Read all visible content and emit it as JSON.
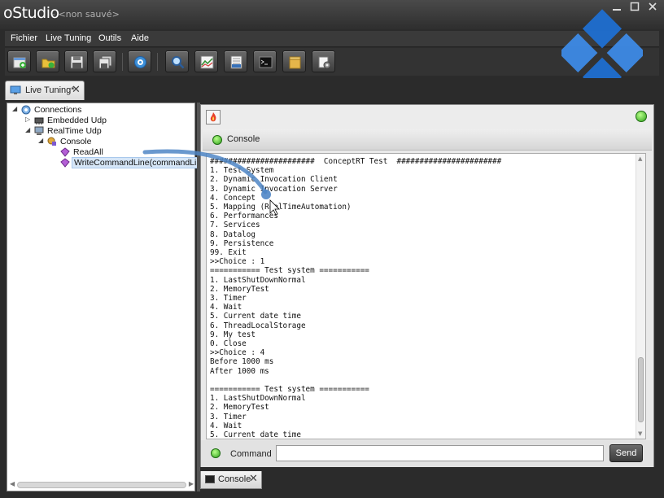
{
  "window": {
    "app_name": "oStudio",
    "subtitle": "- <non sauvé>"
  },
  "menu": {
    "items": [
      {
        "label": "Fichier"
      },
      {
        "label": "Live Tuning"
      },
      {
        "label": "Outils"
      },
      {
        "label": "Aide"
      }
    ]
  },
  "toolbar": {
    "icons": [
      "new-project-icon",
      "open-folder-icon",
      "save-icon",
      "save-all-icon",
      "settings-gear-icon",
      "search-icon",
      "chart-icon",
      "log-icon",
      "terminal-icon",
      "package-icon",
      "plugin-icon"
    ]
  },
  "tabs": {
    "document_tab": "Live Tuning*",
    "bottom_tab": "Console"
  },
  "tree": {
    "root": "Connections",
    "embedded": "Embedded Udp",
    "realtime": "RealTime Udp",
    "console": "Console",
    "read_all": "ReadAll",
    "write_cmd": "WriteCommandLine(commandLine)"
  },
  "console": {
    "header": "Console",
    "lines": [
      "#######################  ConceptRT Test  #######################",
      "1. Test System",
      "2. Dynamic Invocation Client",
      "3. Dynamic Invocation Server",
      "4. Concept",
      "5. Mapping (RealTimeAutomation)",
      "6. Performances",
      "7. Services",
      "8. Datalog",
      "9. Persistence",
      "99. Exit",
      ">>Choice : 1",
      "=========== Test system ===========",
      "1. LastShutDownNormal",
      "2. MemoryTest",
      "3. Timer",
      "4. Wait",
      "5. Current date time",
      "6. ThreadLocalStorage",
      "9. My test",
      "0. Close",
      ">>Choice : 4",
      "Before 1000 ms",
      "After 1000 ms",
      "",
      "=========== Test system ===========",
      "1. LastShutDownNormal",
      "2. MemoryTest",
      "3. Timer",
      "4. Wait",
      "5. Current date time"
    ]
  },
  "command": {
    "label": "Command",
    "value": "",
    "send_label": "Send"
  },
  "colors": {
    "accent_blue": "#1f6fd1",
    "status_green": "#2fa11c"
  }
}
